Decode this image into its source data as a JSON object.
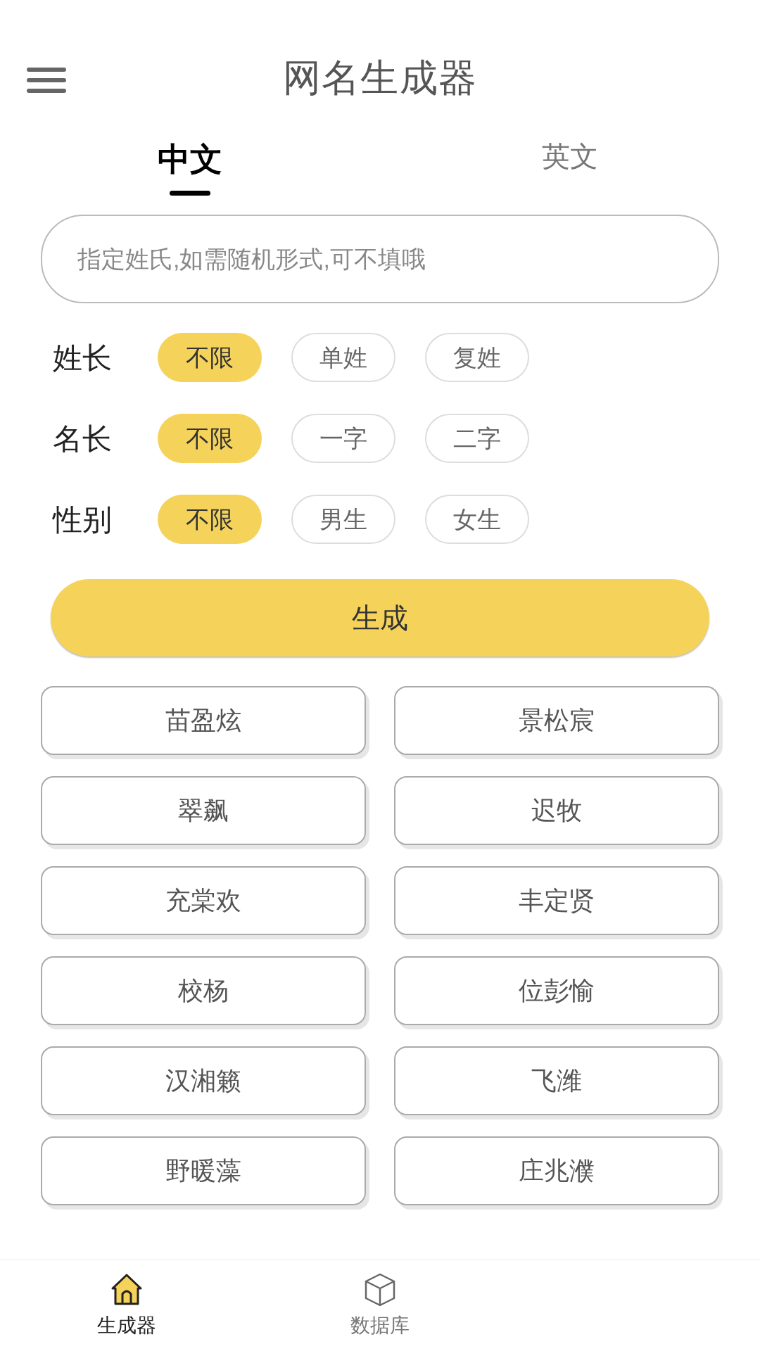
{
  "header": {
    "title": "网名生成器"
  },
  "tabs": [
    {
      "label": "中文",
      "selected": true
    },
    {
      "label": "英文",
      "selected": false
    }
  ],
  "surname_field": {
    "placeholder": "指定姓氏,如需随机形式,可不填哦"
  },
  "options": [
    {
      "label": "姓长",
      "choices": [
        {
          "label": "不限",
          "selected": true
        },
        {
          "label": "单姓",
          "selected": false
        },
        {
          "label": "复姓",
          "selected": false
        }
      ]
    },
    {
      "label": "名长",
      "choices": [
        {
          "label": "不限",
          "selected": true
        },
        {
          "label": "一字",
          "selected": false
        },
        {
          "label": "二字",
          "selected": false
        }
      ]
    },
    {
      "label": "性别",
      "choices": [
        {
          "label": "不限",
          "selected": true
        },
        {
          "label": "男生",
          "selected": false
        },
        {
          "label": "女生",
          "selected": false
        }
      ]
    }
  ],
  "generate_button": "生成",
  "names": [
    "苗盈炫",
    "景松宸",
    "翠飙",
    "迟牧",
    "充棠欢",
    "丰定贤",
    "校杨",
    "位彭愉",
    "汉湘籁",
    "飞潍",
    "野暖藻",
    "庄兆濮"
  ],
  "bottom_nav": [
    {
      "label": "生成器",
      "kind": "home",
      "selected": true
    },
    {
      "label": "数据库",
      "kind": "database",
      "selected": false
    }
  ]
}
